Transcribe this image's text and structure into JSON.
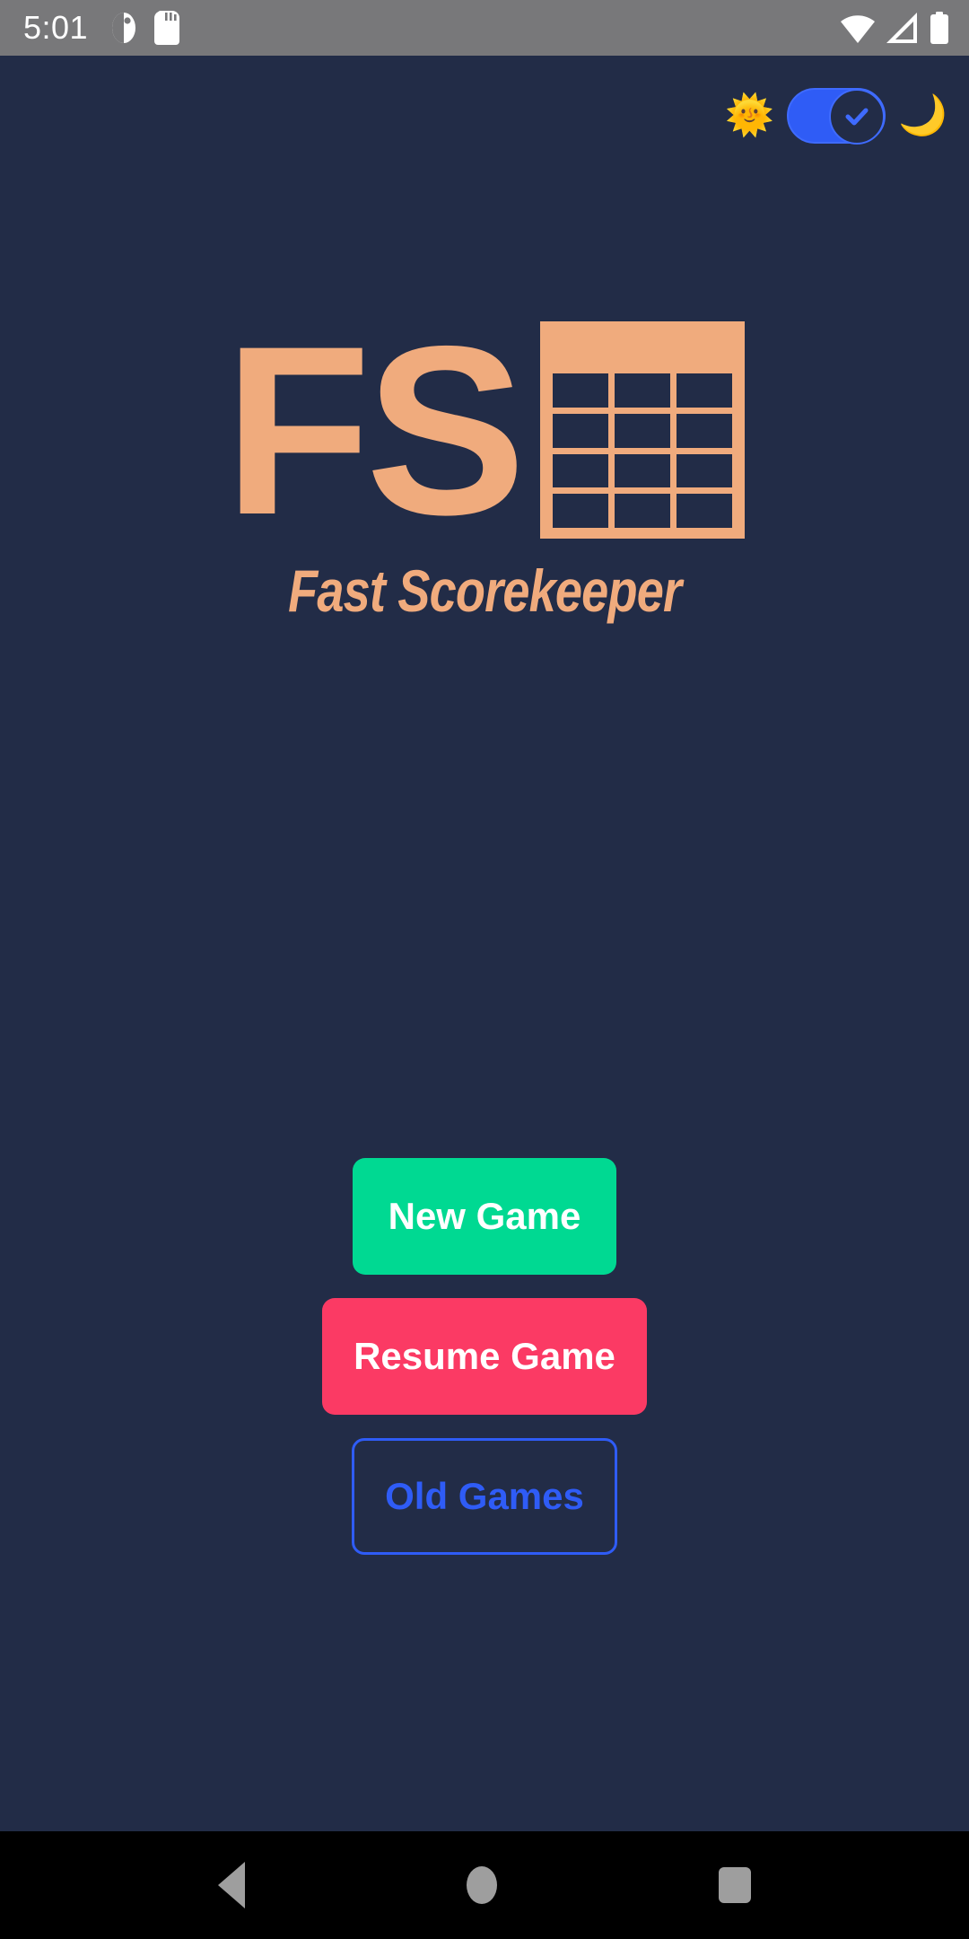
{
  "status_bar": {
    "time": "5:01",
    "left_icons": [
      "do-not-disturb-icon",
      "sd-card-icon"
    ],
    "right_icons": [
      "wifi-icon",
      "cellular-signal-icon",
      "battery-icon"
    ],
    "background_color": "#78787a"
  },
  "theme_toggle": {
    "sun_emoji": "🌞",
    "moon_emoji": "🌙",
    "state": "on",
    "checked_glyph": "✓",
    "track_color": "#2f5cf6",
    "knob_color": "#222c47",
    "check_color": "#3f6bff"
  },
  "logo": {
    "letters": "FS",
    "grid_rows": 4,
    "grid_cols": 3,
    "accent_color": "#f0ab7d",
    "cell_color": "#222c47"
  },
  "app": {
    "title": "Fast Scorekeeper",
    "background_color": "#222c47"
  },
  "buttons": {
    "new_game": {
      "label": "New Game",
      "color": "#00d992",
      "text_color": "#ffffff"
    },
    "resume_game": {
      "label": "Resume Game",
      "color": "#fb3a64",
      "text_color": "#ffffff"
    },
    "old_games": {
      "label": "Old Games",
      "color": "#2f5cf6",
      "text_color": "#2f5cf6"
    }
  },
  "nav_bar": {
    "back_label": "back-button",
    "home_label": "home-button",
    "recents_label": "recents-button",
    "icon_color": "#9e9e9e",
    "background_color": "#000000"
  }
}
